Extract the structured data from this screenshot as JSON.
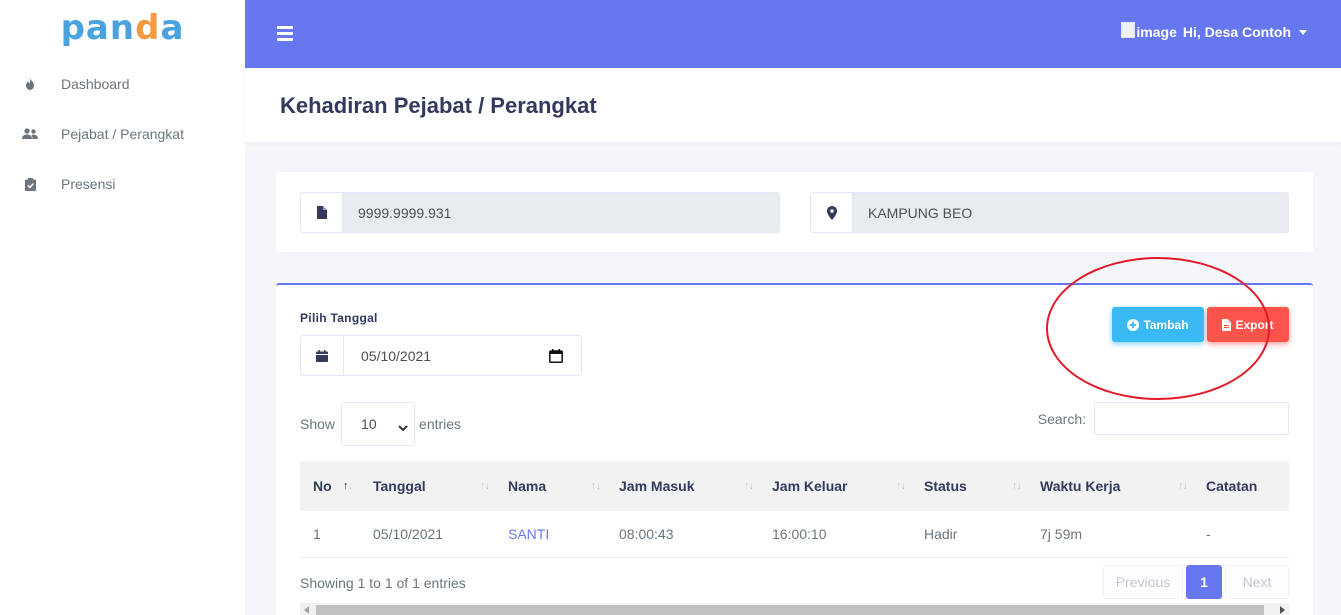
{
  "brand": {
    "logo_text_1": "pan",
    "logo_text_2": "d",
    "logo_text_3": "a"
  },
  "sidebar": {
    "items": [
      {
        "label": "Dashboard",
        "icon": "fire-icon"
      },
      {
        "label": "Pejabat / Perangkat",
        "icon": "users-icon"
      },
      {
        "label": "Presensi",
        "icon": "clipboard-check-icon"
      }
    ]
  },
  "topbar": {
    "broken_image_alt": "image",
    "user_greeting": "Hi, Desa Contoh"
  },
  "page": {
    "title": "Kehadiran Pejabat / Perangkat"
  },
  "info": {
    "code_value": "9999.9999.931",
    "location_value": "KAMPUNG BEO"
  },
  "filter": {
    "date_label": "Pilih Tanggal",
    "date_value": "05/10/2021"
  },
  "actions": {
    "add_label": "Tambah",
    "export_label": "Export"
  },
  "table_controls": {
    "show_label": "Show",
    "entries_value": "10",
    "entries_label": "entries",
    "search_label": "Search:"
  },
  "table": {
    "columns": [
      "No",
      "Tanggal",
      "Nama",
      "Jam Masuk",
      "Jam Keluar",
      "Status",
      "Waktu Kerja",
      "Catatan"
    ],
    "rows": [
      [
        "1",
        "05/10/2021",
        "SANTI",
        "08:00:43",
        "16:00:10",
        "Hadir",
        "7j 59m",
        "-"
      ]
    ]
  },
  "footer": {
    "info": "Showing 1 to 1 of 1 entries",
    "prev_label": "Previous",
    "current_page": "1",
    "next_label": "Next"
  },
  "colors": {
    "primary": "#6777ef",
    "info": "#3abaf4",
    "danger": "#fc544b",
    "annotation": "#e21a2a"
  }
}
